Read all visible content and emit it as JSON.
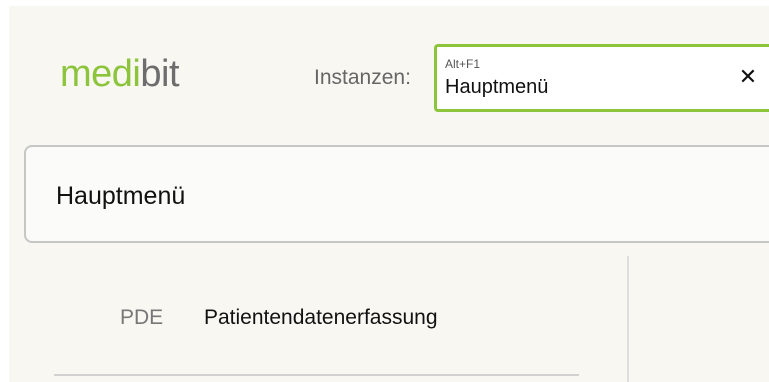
{
  "header": {
    "logo": {
      "part1": "medi",
      "part2": "bit"
    },
    "instances_label": "Instanzen:",
    "instance_field": {
      "shortcut": "Alt+F1",
      "value": "Hauptmenü",
      "clear_icon": "close-icon",
      "clear_glyph": "✕"
    }
  },
  "main": {
    "title": "Hauptmenü",
    "items": [
      {
        "code": "PDE",
        "label": "Patientendatenerfassung"
      }
    ]
  },
  "colors": {
    "accent": "#8cc43c",
    "logo_secondary": "#6d6d6d",
    "background": "#f8f7f2"
  }
}
